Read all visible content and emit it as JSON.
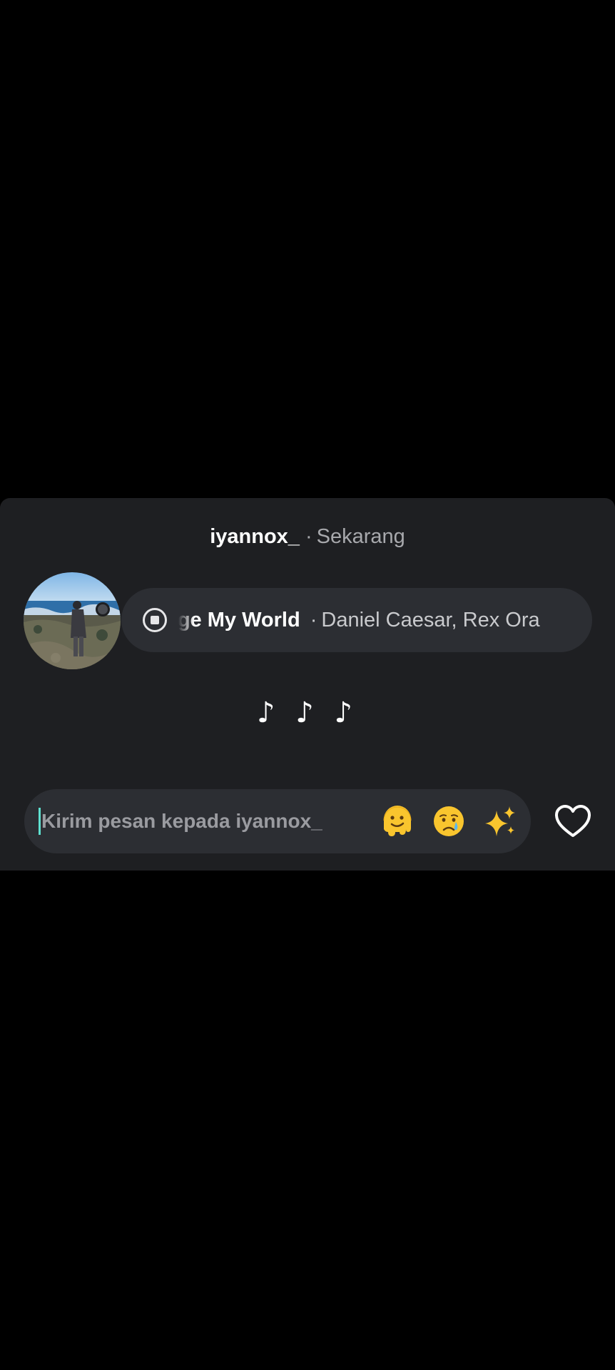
{
  "header": {
    "username": "iyannox_",
    "separator": "·",
    "time": "Sekarang"
  },
  "music": {
    "song_visible": "ange My World",
    "separator": "·",
    "artists_visible": "Daniel Caesar, Rex Ora",
    "state_icon": "stop-icon"
  },
  "note": {
    "text": "♪ ♪ ♪"
  },
  "reply": {
    "placeholder": "Kirim pesan kepada iyannox_",
    "quick_reactions": [
      "melting-face-icon",
      "crying-face-icon",
      "sparkles-icon"
    ],
    "like_icon": "heart-icon"
  },
  "colors": {
    "background": "#000000",
    "sheet": "#1e1f22",
    "pill": "#2c2e33",
    "muted_text": "#a8a9ad",
    "cursor": "#5ee0d0"
  }
}
